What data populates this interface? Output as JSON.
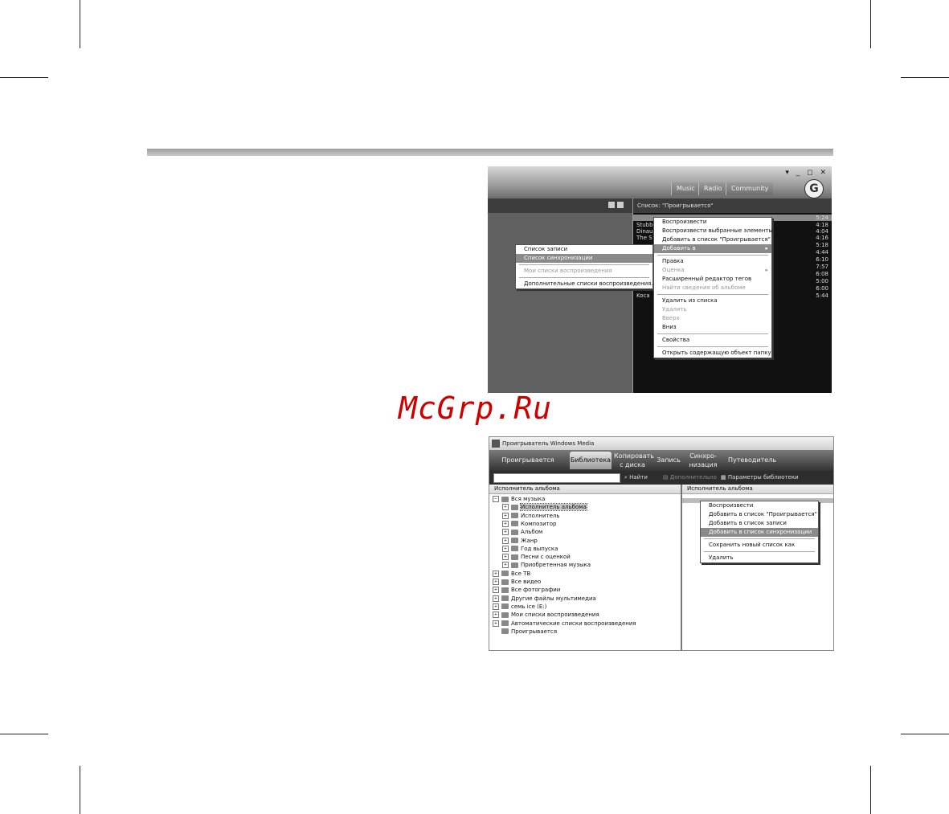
{
  "watermark": "McGrp.Ru",
  "shot1": {
    "tabs": [
      "Music",
      "Radio",
      "Community"
    ],
    "window_controls": "▾ _ ◻ ✕",
    "list_label": "Список: \"Проигрывается\"",
    "tracks": [
      {
        "title": "Stubb",
        "duration": "4:18"
      },
      {
        "title": "Dinau",
        "duration": "4:04"
      },
      {
        "title": "The S",
        "duration": "4:16"
      },
      {
        "title": "",
        "duration": "5:18"
      },
      {
        "title": "",
        "duration": "4:44"
      },
      {
        "title": "",
        "duration": "6:10"
      },
      {
        "title": "",
        "duration": "7:57"
      },
      {
        "title": "",
        "duration": "6:08"
      },
      {
        "title": "",
        "duration": "5:00"
      },
      {
        "title": "",
        "duration": "6:00"
      },
      {
        "title": "Koca",
        "duration": "5:44"
      }
    ],
    "first_duration": "5:24",
    "submenu": {
      "items": [
        {
          "label": "Список записи",
          "state": "normal"
        },
        {
          "label": "Список синхронизации",
          "state": "highlight"
        },
        {
          "label": "Мои списки воспроизведения",
          "state": "disabled"
        },
        {
          "label": "Дополнительные списки воспроизведения...",
          "state": "normal"
        }
      ]
    },
    "context_menu": {
      "items": [
        {
          "label": "Воспроизвести",
          "state": "normal"
        },
        {
          "label": "Воспроизвести выбранные элементы",
          "state": "normal"
        },
        {
          "label": "Добавить в список \"Проигрывается\"",
          "state": "normal"
        },
        {
          "label": "Добавить в",
          "state": "highlight",
          "arrow": "▸"
        },
        {
          "label": "Правка",
          "state": "normal"
        },
        {
          "label": "Оценка",
          "state": "disabled",
          "arrow": "▸"
        },
        {
          "label": "Расширенный редактор тегов",
          "state": "normal"
        },
        {
          "label": "Найти сведения об альбоме",
          "state": "disabled"
        },
        {
          "label": "Удалить из списка",
          "state": "normal"
        },
        {
          "label": "Удалить",
          "state": "disabled"
        },
        {
          "label": "Вверх",
          "state": "disabled"
        },
        {
          "label": "Вниз",
          "state": "normal"
        },
        {
          "label": "Свойства",
          "state": "normal"
        },
        {
          "label": "Открыть содержащую объект папку",
          "state": "normal"
        }
      ]
    }
  },
  "shot2": {
    "title": "Проигрыватель Windows Media",
    "nav_tabs": [
      {
        "label": "Проигрывается",
        "active": false
      },
      {
        "label": "Библиотека",
        "active": true
      },
      {
        "label": "Копировать с диска",
        "active": false
      },
      {
        "label": "Запись",
        "active": false
      },
      {
        "label": "Синхро-низация",
        "active": false
      },
      {
        "label": "Путеводитель",
        "active": false
      }
    ],
    "find_label": "Найти",
    "more_label": "Дополнительно",
    "lib_params_label": "Параметры библиотеки",
    "left_header": "Исполнитель альбома",
    "right_header": "Исполнитель альбома",
    "tree": [
      {
        "label": "Вся музыка",
        "level": 0,
        "pm": "−"
      },
      {
        "label": "Исполнитель альбома",
        "level": 1,
        "pm": "+",
        "hl": true
      },
      {
        "label": "Исполнитель",
        "level": 1,
        "pm": "+"
      },
      {
        "label": "Композитор",
        "level": 1,
        "pm": "+"
      },
      {
        "label": "Альбом",
        "level": 1,
        "pm": "+"
      },
      {
        "label": "Жанр",
        "level": 1,
        "pm": "+"
      },
      {
        "label": "Год выпуска",
        "level": 1,
        "pm": "+"
      },
      {
        "label": "Песни с оценкой",
        "level": 1,
        "pm": "+"
      },
      {
        "label": "Приобретенная музыка",
        "level": 1,
        "pm": "+"
      },
      {
        "label": "Все ТВ",
        "level": 0,
        "pm": "+"
      },
      {
        "label": "Все видео",
        "level": 0,
        "pm": "+"
      },
      {
        "label": "Все фотографии",
        "level": 0,
        "pm": "+"
      },
      {
        "label": "Другие файлы мультимедиа",
        "level": 0,
        "pm": "+"
      },
      {
        "label": "семь ice (E:)",
        "level": 0,
        "pm": "+"
      },
      {
        "label": "Мои списки воспроизведения",
        "level": 0,
        "pm": "+"
      },
      {
        "label": "Автоматические списки воспроизведения",
        "level": 0,
        "pm": "+"
      },
      {
        "label": "Проигрывается",
        "level": 0,
        "pm": ""
      }
    ],
    "context_menu": {
      "items": [
        {
          "label": "Воспроизвести",
          "state": "normal"
        },
        {
          "label": "Добавить в список \"Проигрывается\"",
          "state": "normal"
        },
        {
          "label": "Добавить в список записи",
          "state": "normal"
        },
        {
          "label": "Добавить в список синхронизации",
          "state": "highlight"
        },
        {
          "label": "Сохранить новый список как",
          "state": "normal"
        },
        {
          "label": "Удалить",
          "state": "normal"
        }
      ]
    }
  }
}
